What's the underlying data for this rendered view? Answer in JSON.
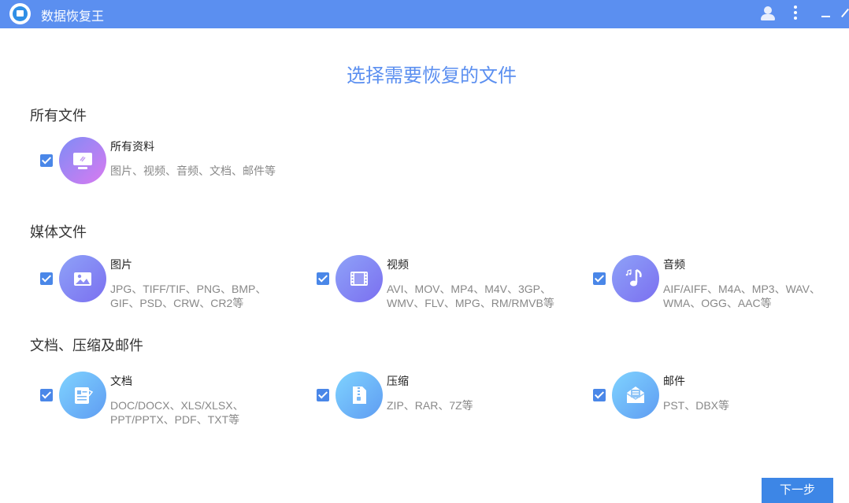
{
  "titlebar": {
    "app_title": "数据恢复王"
  },
  "page_title": "选择需要恢复的文件",
  "sections": {
    "all": {
      "title": "所有文件",
      "items": [
        {
          "label": "所有资料",
          "desc": "图片、视频、音频、文档、邮件等",
          "checked": true,
          "icon": "monitor-icon"
        }
      ]
    },
    "media": {
      "title": "媒体文件",
      "items": [
        {
          "label": "图片",
          "desc": "JPG、TIFF/TIF、PNG、BMP、GIF、PSD、CRW、CR2等",
          "checked": true,
          "icon": "image-icon"
        },
        {
          "label": "视频",
          "desc": "AVI、MOV、MP4、M4V、3GP、WMV、FLV、MPG、RM/RMVB等",
          "checked": true,
          "icon": "film-icon"
        },
        {
          "label": "音频",
          "desc": "AIF/AIFF、M4A、MP3、WAV、WMA、OGG、AAC等",
          "checked": true,
          "icon": "music-note-icon"
        }
      ]
    },
    "docs": {
      "title": "文档、压缩及邮件",
      "items": [
        {
          "label": "文档",
          "desc": "DOC/DOCX、XLS/XLSX、PPT/PPTX、PDF、TXT等",
          "checked": true,
          "icon": "document-icon"
        },
        {
          "label": "压缩",
          "desc": "ZIP、RAR、7Z等",
          "checked": true,
          "icon": "zip-icon"
        },
        {
          "label": "邮件",
          "desc": "PST、DBX等",
          "checked": true,
          "icon": "envelope-icon"
        }
      ]
    }
  },
  "next_button": "下一步",
  "colors": {
    "titlebar": "#5b8ff0",
    "accent": "#4a87e8",
    "button": "#3d86e6"
  }
}
